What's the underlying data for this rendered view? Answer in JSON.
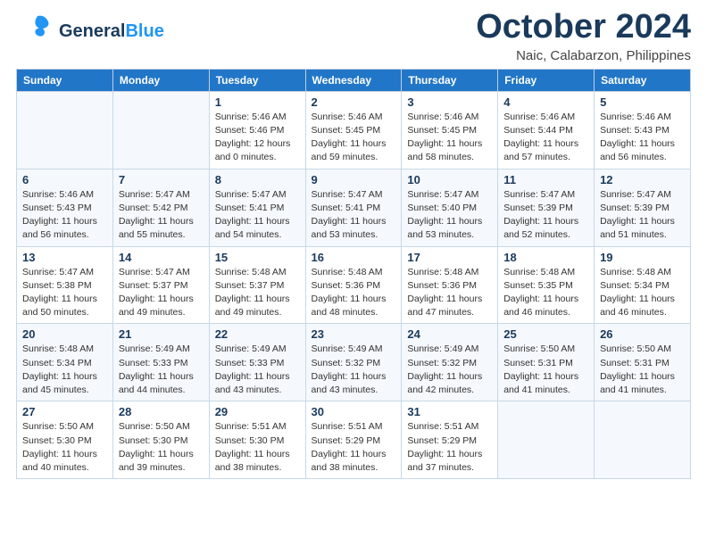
{
  "header": {
    "logo_general": "General",
    "logo_blue": "Blue",
    "month_title": "October 2024",
    "location": "Naic, Calabarzon, Philippines"
  },
  "weekdays": [
    "Sunday",
    "Monday",
    "Tuesday",
    "Wednesday",
    "Thursday",
    "Friday",
    "Saturday"
  ],
  "weeks": [
    [
      {
        "day": "",
        "sunrise": "",
        "sunset": "",
        "daylight": ""
      },
      {
        "day": "",
        "sunrise": "",
        "sunset": "",
        "daylight": ""
      },
      {
        "day": "1",
        "sunrise": "Sunrise: 5:46 AM",
        "sunset": "Sunset: 5:46 PM",
        "daylight": "Daylight: 12 hours and 0 minutes."
      },
      {
        "day": "2",
        "sunrise": "Sunrise: 5:46 AM",
        "sunset": "Sunset: 5:45 PM",
        "daylight": "Daylight: 11 hours and 59 minutes."
      },
      {
        "day": "3",
        "sunrise": "Sunrise: 5:46 AM",
        "sunset": "Sunset: 5:45 PM",
        "daylight": "Daylight: 11 hours and 58 minutes."
      },
      {
        "day": "4",
        "sunrise": "Sunrise: 5:46 AM",
        "sunset": "Sunset: 5:44 PM",
        "daylight": "Daylight: 11 hours and 57 minutes."
      },
      {
        "day": "5",
        "sunrise": "Sunrise: 5:46 AM",
        "sunset": "Sunset: 5:43 PM",
        "daylight": "Daylight: 11 hours and 56 minutes."
      }
    ],
    [
      {
        "day": "6",
        "sunrise": "Sunrise: 5:46 AM",
        "sunset": "Sunset: 5:43 PM",
        "daylight": "Daylight: 11 hours and 56 minutes."
      },
      {
        "day": "7",
        "sunrise": "Sunrise: 5:47 AM",
        "sunset": "Sunset: 5:42 PM",
        "daylight": "Daylight: 11 hours and 55 minutes."
      },
      {
        "day": "8",
        "sunrise": "Sunrise: 5:47 AM",
        "sunset": "Sunset: 5:41 PM",
        "daylight": "Daylight: 11 hours and 54 minutes."
      },
      {
        "day": "9",
        "sunrise": "Sunrise: 5:47 AM",
        "sunset": "Sunset: 5:41 PM",
        "daylight": "Daylight: 11 hours and 53 minutes."
      },
      {
        "day": "10",
        "sunrise": "Sunrise: 5:47 AM",
        "sunset": "Sunset: 5:40 PM",
        "daylight": "Daylight: 11 hours and 53 minutes."
      },
      {
        "day": "11",
        "sunrise": "Sunrise: 5:47 AM",
        "sunset": "Sunset: 5:39 PM",
        "daylight": "Daylight: 11 hours and 52 minutes."
      },
      {
        "day": "12",
        "sunrise": "Sunrise: 5:47 AM",
        "sunset": "Sunset: 5:39 PM",
        "daylight": "Daylight: 11 hours and 51 minutes."
      }
    ],
    [
      {
        "day": "13",
        "sunrise": "Sunrise: 5:47 AM",
        "sunset": "Sunset: 5:38 PM",
        "daylight": "Daylight: 11 hours and 50 minutes."
      },
      {
        "day": "14",
        "sunrise": "Sunrise: 5:47 AM",
        "sunset": "Sunset: 5:37 PM",
        "daylight": "Daylight: 11 hours and 49 minutes."
      },
      {
        "day": "15",
        "sunrise": "Sunrise: 5:48 AM",
        "sunset": "Sunset: 5:37 PM",
        "daylight": "Daylight: 11 hours and 49 minutes."
      },
      {
        "day": "16",
        "sunrise": "Sunrise: 5:48 AM",
        "sunset": "Sunset: 5:36 PM",
        "daylight": "Daylight: 11 hours and 48 minutes."
      },
      {
        "day": "17",
        "sunrise": "Sunrise: 5:48 AM",
        "sunset": "Sunset: 5:36 PM",
        "daylight": "Daylight: 11 hours and 47 minutes."
      },
      {
        "day": "18",
        "sunrise": "Sunrise: 5:48 AM",
        "sunset": "Sunset: 5:35 PM",
        "daylight": "Daylight: 11 hours and 46 minutes."
      },
      {
        "day": "19",
        "sunrise": "Sunrise: 5:48 AM",
        "sunset": "Sunset: 5:34 PM",
        "daylight": "Daylight: 11 hours and 46 minutes."
      }
    ],
    [
      {
        "day": "20",
        "sunrise": "Sunrise: 5:48 AM",
        "sunset": "Sunset: 5:34 PM",
        "daylight": "Daylight: 11 hours and 45 minutes."
      },
      {
        "day": "21",
        "sunrise": "Sunrise: 5:49 AM",
        "sunset": "Sunset: 5:33 PM",
        "daylight": "Daylight: 11 hours and 44 minutes."
      },
      {
        "day": "22",
        "sunrise": "Sunrise: 5:49 AM",
        "sunset": "Sunset: 5:33 PM",
        "daylight": "Daylight: 11 hours and 43 minutes."
      },
      {
        "day": "23",
        "sunrise": "Sunrise: 5:49 AM",
        "sunset": "Sunset: 5:32 PM",
        "daylight": "Daylight: 11 hours and 43 minutes."
      },
      {
        "day": "24",
        "sunrise": "Sunrise: 5:49 AM",
        "sunset": "Sunset: 5:32 PM",
        "daylight": "Daylight: 11 hours and 42 minutes."
      },
      {
        "day": "25",
        "sunrise": "Sunrise: 5:50 AM",
        "sunset": "Sunset: 5:31 PM",
        "daylight": "Daylight: 11 hours and 41 minutes."
      },
      {
        "day": "26",
        "sunrise": "Sunrise: 5:50 AM",
        "sunset": "Sunset: 5:31 PM",
        "daylight": "Daylight: 11 hours and 41 minutes."
      }
    ],
    [
      {
        "day": "27",
        "sunrise": "Sunrise: 5:50 AM",
        "sunset": "Sunset: 5:30 PM",
        "daylight": "Daylight: 11 hours and 40 minutes."
      },
      {
        "day": "28",
        "sunrise": "Sunrise: 5:50 AM",
        "sunset": "Sunset: 5:30 PM",
        "daylight": "Daylight: 11 hours and 39 minutes."
      },
      {
        "day": "29",
        "sunrise": "Sunrise: 5:51 AM",
        "sunset": "Sunset: 5:30 PM",
        "daylight": "Daylight: 11 hours and 38 minutes."
      },
      {
        "day": "30",
        "sunrise": "Sunrise: 5:51 AM",
        "sunset": "Sunset: 5:29 PM",
        "daylight": "Daylight: 11 hours and 38 minutes."
      },
      {
        "day": "31",
        "sunrise": "Sunrise: 5:51 AM",
        "sunset": "Sunset: 5:29 PM",
        "daylight": "Daylight: 11 hours and 37 minutes."
      },
      {
        "day": "",
        "sunrise": "",
        "sunset": "",
        "daylight": ""
      },
      {
        "day": "",
        "sunrise": "",
        "sunset": "",
        "daylight": ""
      }
    ]
  ]
}
